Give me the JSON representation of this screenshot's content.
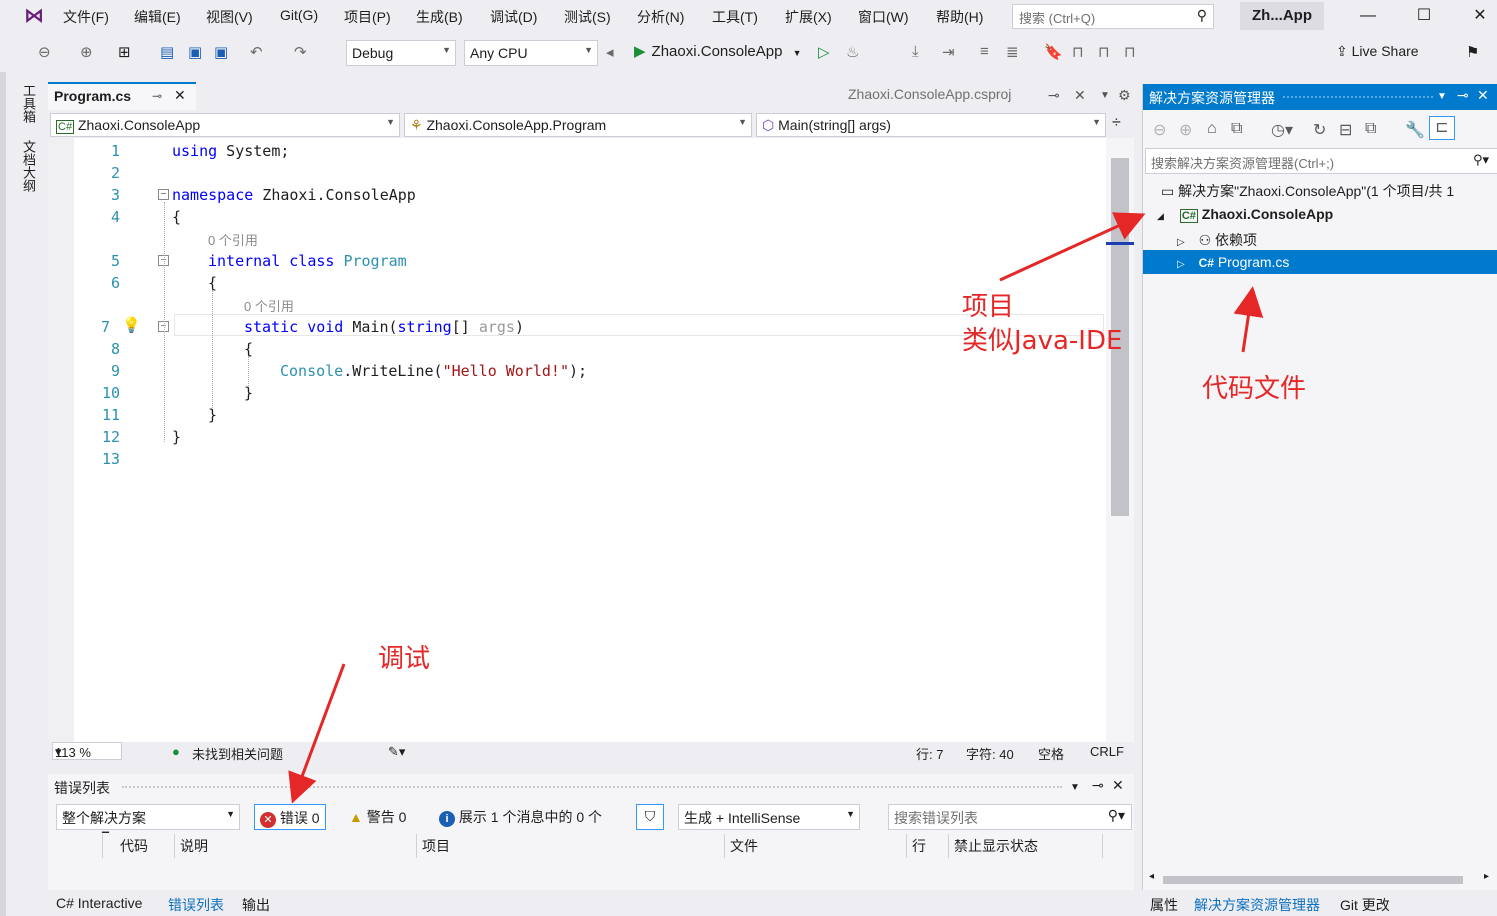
{
  "window": {
    "title": "Zh...App",
    "controls": [
      "—",
      "☐",
      "✕"
    ]
  },
  "menu": [
    "文件(F)",
    "编辑(E)",
    "视图(V)",
    "Git(G)",
    "项目(P)",
    "生成(B)",
    "调试(D)",
    "测试(S)",
    "分析(N)",
    "工具(T)",
    "扩展(X)",
    "窗口(W)",
    "帮助(H)"
  ],
  "search": {
    "placeholder": "搜索 (Ctrl+Q)"
  },
  "toolbar": {
    "config": "Debug",
    "platform": "Any CPU",
    "run_target": "Zhaoxi.ConsoleApp",
    "live_share": "Live Share"
  },
  "left_sidebar": [
    "工具箱",
    "文档大纲"
  ],
  "doc_tabs": {
    "active": "Program.cs",
    "preview": "Zhaoxi.ConsoleApp.csproj"
  },
  "navbar": {
    "project": "Zhaoxi.ConsoleApp",
    "class": "Zhaoxi.ConsoleApp.Program",
    "member": "Main(string[] args)"
  },
  "code": {
    "line_numbers": [
      "1",
      "2",
      "3",
      "4",
      "5",
      "6",
      "7",
      "8",
      "9",
      "10",
      "11",
      "12",
      "13"
    ],
    "using_kw": "using",
    "using_ns": " System;",
    "namespace_kw": "namespace",
    "namespace_name": " Zhaoxi.ConsoleApp",
    "ref_hint": "0 个引用",
    "internal_kw": "internal",
    "class_kw": "class",
    "class_name": "Program",
    "static_kw": "static",
    "void_kw": "void",
    "main_name": " Main(",
    "string_kw": "string",
    "args_part": "[] ",
    "args_name": "args",
    "close_paren": ")",
    "console": "Console",
    "writeline": ".WriteLine(",
    "hello": "\"Hello World!\"",
    "end_stmt": ");",
    "open_brace": "{",
    "close_brace": "}"
  },
  "editor_status": {
    "zoom": "113 %",
    "issues": "未找到相关问题",
    "line": "行: 7",
    "char": "字符: 40",
    "space": "空格",
    "eol": "CRLF"
  },
  "error_list": {
    "title": "错误列表",
    "scope": "整个解决方案",
    "errors_label": "错误",
    "errors_count": "0",
    "warnings_label": "警告",
    "warnings_count": "0",
    "messages": "展示 1 个消息中的 0 个",
    "source": "生成 + IntelliSense",
    "search_placeholder": "搜索错误列表",
    "columns": [
      "代码",
      "说明",
      "项目",
      "文件",
      "行",
      "禁止显示状态"
    ]
  },
  "bottom_tabs": [
    "C# Interactive",
    "错误列表",
    "输出"
  ],
  "solution_explorer": {
    "title": "解决方案资源管理器",
    "search_placeholder": "搜索解决方案资源管理器(Ctrl+;)",
    "solution_node": "解决方案\"Zhaoxi.ConsoleApp\"(1 个项目/共 1",
    "project_node": "Zhaoxi.ConsoleApp",
    "dependencies_node": "依赖项",
    "file_node": "Program.cs",
    "tabs": [
      "属性",
      "解决方案资源管理器",
      "Git 更改"
    ]
  },
  "annotations": {
    "project_line1": "项目",
    "project_line2": "类似Java-IDE",
    "code_file": "代码文件",
    "debug": "调试"
  },
  "colors": {
    "accent": "#007acc",
    "annotation": "#e52727",
    "keyword": "#0000ff",
    "type": "#2b91af",
    "string": "#a31515"
  }
}
